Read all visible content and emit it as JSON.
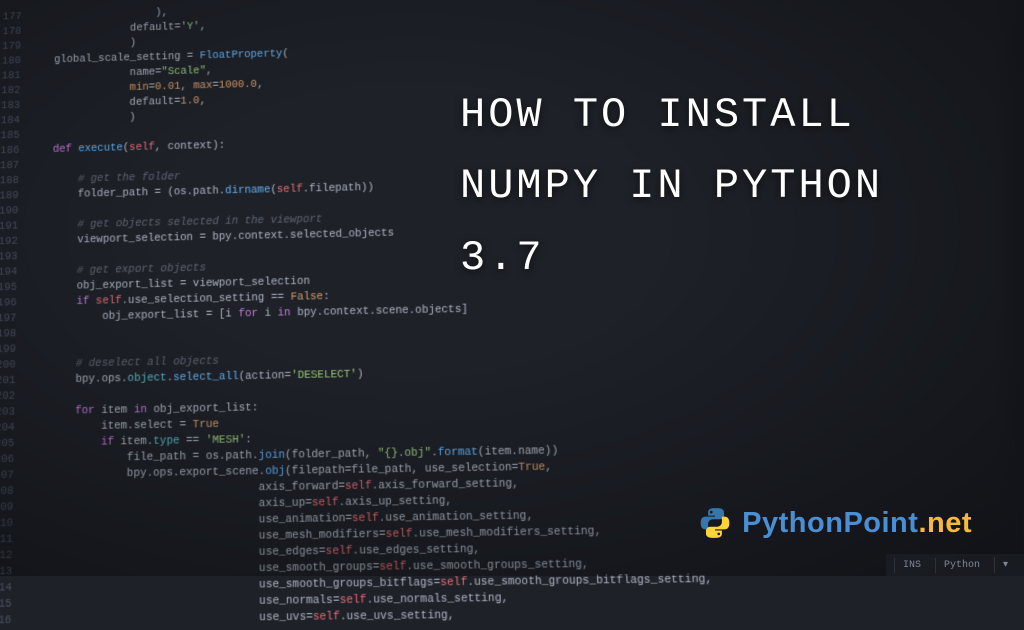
{
  "title": "HOW TO INSTALL NUMPY IN PYTHON 3.7",
  "logo": {
    "text_main": "PythonPoint",
    "text_tld": ".net"
  },
  "statusbar": {
    "mode": "INS",
    "lang": "Python"
  },
  "gutter_start": 177,
  "code_lines": [
    {
      "indent": 20,
      "tokens": [
        [
          "plain",
          "),"
        ]
      ]
    },
    {
      "indent": 16,
      "tokens": [
        [
          "plain",
          "default="
        ],
        [
          "str",
          "'Y'"
        ],
        [
          "plain",
          ","
        ]
      ]
    },
    {
      "indent": 16,
      "tokens": [
        [
          "plain",
          ")"
        ]
      ]
    },
    {
      "indent": 4,
      "tokens": [
        [
          "plain",
          "global_scale_setting = "
        ],
        [
          "fn",
          "FloatProperty"
        ],
        [
          "plain",
          "("
        ]
      ]
    },
    {
      "indent": 16,
      "tokens": [
        [
          "plain",
          "name="
        ],
        [
          "str",
          "\"Scale\""
        ],
        [
          "plain",
          ","
        ]
      ]
    },
    {
      "indent": 16,
      "tokens": [
        [
          "attr",
          "min"
        ],
        [
          "plain",
          "="
        ],
        [
          "num",
          "0.01"
        ],
        [
          "plain",
          ", "
        ],
        [
          "attr",
          "max"
        ],
        [
          "plain",
          "="
        ],
        [
          "num",
          "1000.0"
        ],
        [
          "plain",
          ","
        ]
      ]
    },
    {
      "indent": 16,
      "tokens": [
        [
          "plain",
          "default="
        ],
        [
          "num",
          "1.0"
        ],
        [
          "plain",
          ","
        ]
      ]
    },
    {
      "indent": 16,
      "tokens": [
        [
          "plain",
          ")"
        ]
      ]
    },
    {
      "indent": 0,
      "tokens": [
        [
          "plain",
          ""
        ]
      ]
    },
    {
      "indent": 4,
      "tokens": [
        [
          "kw",
          "def "
        ],
        [
          "fn",
          "execute"
        ],
        [
          "plain",
          "("
        ],
        [
          "self",
          "self"
        ],
        [
          "plain",
          ", context):"
        ]
      ]
    },
    {
      "indent": 0,
      "tokens": [
        [
          "plain",
          ""
        ]
      ]
    },
    {
      "indent": 8,
      "tokens": [
        [
          "cmt",
          "# get the folder"
        ]
      ]
    },
    {
      "indent": 8,
      "tokens": [
        [
          "plain",
          "folder_path = (os.path."
        ],
        [
          "fn",
          "dirname"
        ],
        [
          "plain",
          "("
        ],
        [
          "self",
          "self"
        ],
        [
          "plain",
          ".filepath))"
        ]
      ]
    },
    {
      "indent": 0,
      "tokens": [
        [
          "plain",
          ""
        ]
      ]
    },
    {
      "indent": 8,
      "tokens": [
        [
          "cmt",
          "# get objects selected in the viewport"
        ]
      ]
    },
    {
      "indent": 8,
      "tokens": [
        [
          "plain",
          "viewport_selection = bpy.context.selected_objects"
        ]
      ]
    },
    {
      "indent": 0,
      "tokens": [
        [
          "plain",
          ""
        ]
      ]
    },
    {
      "indent": 8,
      "tokens": [
        [
          "cmt",
          "# get export objects"
        ]
      ]
    },
    {
      "indent": 8,
      "tokens": [
        [
          "plain",
          "obj_export_list = viewport_selection"
        ]
      ]
    },
    {
      "indent": 8,
      "tokens": [
        [
          "kw",
          "if "
        ],
        [
          "self",
          "self"
        ],
        [
          "plain",
          ".use_selection_setting == "
        ],
        [
          "bool",
          "False"
        ],
        [
          "plain",
          ":"
        ]
      ]
    },
    {
      "indent": 12,
      "tokens": [
        [
          "plain",
          "obj_export_list = [i "
        ],
        [
          "kw",
          "for"
        ],
        [
          "plain",
          " i "
        ],
        [
          "kw",
          "in"
        ],
        [
          "plain",
          " bpy.context.scene.objects]"
        ]
      ]
    },
    {
      "indent": 0,
      "tokens": [
        [
          "plain",
          ""
        ]
      ]
    },
    {
      "indent": 0,
      "tokens": [
        [
          "plain",
          ""
        ]
      ]
    },
    {
      "indent": 8,
      "tokens": [
        [
          "cmt",
          "# deselect all objects"
        ]
      ]
    },
    {
      "indent": 8,
      "tokens": [
        [
          "plain",
          "bpy.ops."
        ],
        [
          "prop",
          "object"
        ],
        [
          "plain",
          "."
        ],
        [
          "fn",
          "select_all"
        ],
        [
          "plain",
          "(action="
        ],
        [
          "str",
          "'DESELECT'"
        ],
        [
          "plain",
          ")"
        ]
      ]
    },
    {
      "indent": 0,
      "tokens": [
        [
          "plain",
          ""
        ]
      ]
    },
    {
      "indent": 8,
      "tokens": [
        [
          "kw",
          "for"
        ],
        [
          "plain",
          " item "
        ],
        [
          "kw",
          "in"
        ],
        [
          "plain",
          " obj_export_list:"
        ]
      ]
    },
    {
      "indent": 12,
      "tokens": [
        [
          "plain",
          "item.select = "
        ],
        [
          "bool",
          "True"
        ]
      ]
    },
    {
      "indent": 12,
      "tokens": [
        [
          "kw",
          "if"
        ],
        [
          "plain",
          " item."
        ],
        [
          "prop",
          "type"
        ],
        [
          "plain",
          " == "
        ],
        [
          "str",
          "'MESH'"
        ],
        [
          "plain",
          ":"
        ]
      ]
    },
    {
      "indent": 16,
      "tokens": [
        [
          "plain",
          "file_path = os.path."
        ],
        [
          "fn",
          "join"
        ],
        [
          "plain",
          "(folder_path, "
        ],
        [
          "str",
          "\"{}.obj\""
        ],
        [
          "plain",
          "."
        ],
        [
          "fn",
          "format"
        ],
        [
          "plain",
          "(item.name))"
        ]
      ]
    },
    {
      "indent": 16,
      "tokens": [
        [
          "plain",
          "bpy.ops.export_scene."
        ],
        [
          "fn",
          "obj"
        ],
        [
          "plain",
          "(filepath=file_path, use_selection="
        ],
        [
          "bool",
          "True"
        ],
        [
          "plain",
          ","
        ]
      ]
    },
    {
      "indent": 36,
      "tokens": [
        [
          "plain",
          "axis_forward="
        ],
        [
          "self",
          "self"
        ],
        [
          "plain",
          ".axis_forward_setting,"
        ]
      ]
    },
    {
      "indent": 36,
      "tokens": [
        [
          "plain",
          "axis_up="
        ],
        [
          "self",
          "self"
        ],
        [
          "plain",
          ".axis_up_setting,"
        ]
      ]
    },
    {
      "indent": 36,
      "tokens": [
        [
          "plain",
          "use_animation="
        ],
        [
          "self",
          "self"
        ],
        [
          "plain",
          ".use_animation_setting,"
        ]
      ]
    },
    {
      "indent": 36,
      "tokens": [
        [
          "plain",
          "use_mesh_modifiers="
        ],
        [
          "self",
          "self"
        ],
        [
          "plain",
          ".use_mesh_modifiers_setting,"
        ]
      ]
    },
    {
      "indent": 36,
      "tokens": [
        [
          "plain",
          "use_edges="
        ],
        [
          "self",
          "self"
        ],
        [
          "plain",
          ".use_edges_setting,"
        ]
      ]
    },
    {
      "indent": 36,
      "tokens": [
        [
          "plain",
          "use_smooth_groups="
        ],
        [
          "self",
          "self"
        ],
        [
          "plain",
          ".use_smooth_groups_setting,"
        ]
      ]
    },
    {
      "indent": 36,
      "tokens": [
        [
          "plain",
          "use_smooth_groups_bitflags="
        ],
        [
          "self",
          "self"
        ],
        [
          "plain",
          ".use_smooth_groups_bitflags_setting,"
        ]
      ]
    },
    {
      "indent": 36,
      "tokens": [
        [
          "plain",
          "use_normals="
        ],
        [
          "self",
          "self"
        ],
        [
          "plain",
          ".use_normals_setting,"
        ]
      ]
    },
    {
      "indent": 36,
      "tokens": [
        [
          "plain",
          "use_uvs="
        ],
        [
          "self",
          "self"
        ],
        [
          "plain",
          ".use_uvs_setting,"
        ]
      ]
    }
  ]
}
